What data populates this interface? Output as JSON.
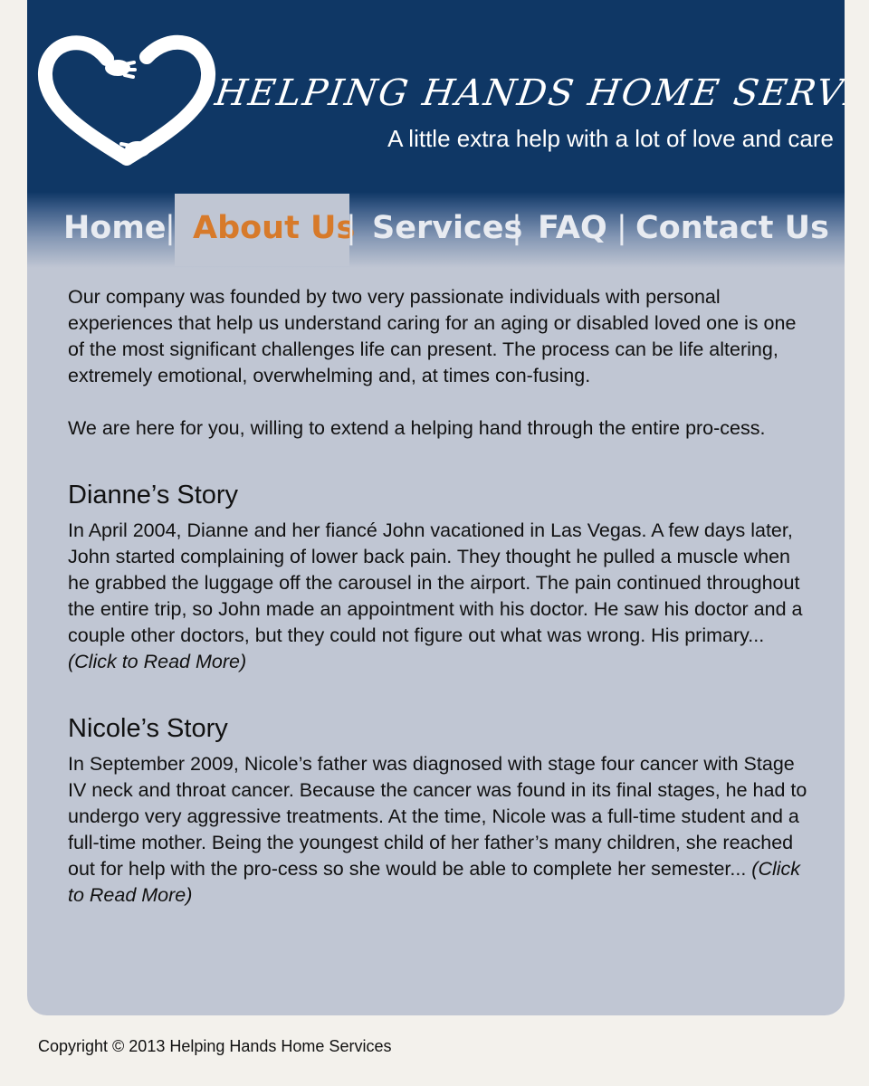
{
  "header": {
    "brand": "HELPING HANDS HOME SERVICES",
    "tagline": "A little extra help with a lot of love and care",
    "logo_icon": "heart-hands-logo-icon"
  },
  "nav": {
    "items": [
      {
        "label": "Home",
        "active": false
      },
      {
        "label": "About Us",
        "active": true
      },
      {
        "label": "Services",
        "active": false
      },
      {
        "label": "FAQ",
        "active": false
      },
      {
        "label": "Contact Us",
        "active": false
      }
    ],
    "separator": "|",
    "active_color": "#d77a2a"
  },
  "intro": {
    "p1": "Our company was founded by two very passionate individuals with personal experiences that help us understand caring for an aging or disabled loved one is one of the most significant challenges life can present. The process can be life altering, extremely emotional, overwhelming and, at times con-fusing.",
    "p2": "We are here for you, willing to extend a helping hand through the entire pro-cess."
  },
  "stories": [
    {
      "title": "Dianne’s Story",
      "excerpt": "In April 2004, Dianne and her fiancé John vacationed in Las Vegas. A few days later, John started complaining of lower back pain. They thought he pulled a muscle when he grabbed the luggage off the carousel in the airport. The pain continued throughout the entire trip, so John made an appointment with his doctor. He saw his doctor and a couple other doctors, but they could not figure out what was wrong. His primary... ",
      "read_more": "(Click to Read More)"
    },
    {
      "title": "Nicole’s Story",
      "excerpt": "In September 2009, Nicole’s father was diagnosed with stage four cancer with Stage IV neck and throat cancer. Because the cancer was found in its final stages, he had to undergo very aggressive treatments.  At the time, Nicole was a full-time student and a full-time mother.  Being the youngest child of her father’s many children, she reached out for help with the pro-cess so she would be able to complete her semester... ",
      "read_more": "(Click to Read More)"
    }
  ],
  "footer": {
    "copyright": "Copyright © 2013 Helping Hands Home Services"
  },
  "colors": {
    "header_bg": "#0f3765",
    "content_bg": "#c0c6d3",
    "page_bg": "#f3f1ec",
    "accent": "#d77a2a"
  }
}
